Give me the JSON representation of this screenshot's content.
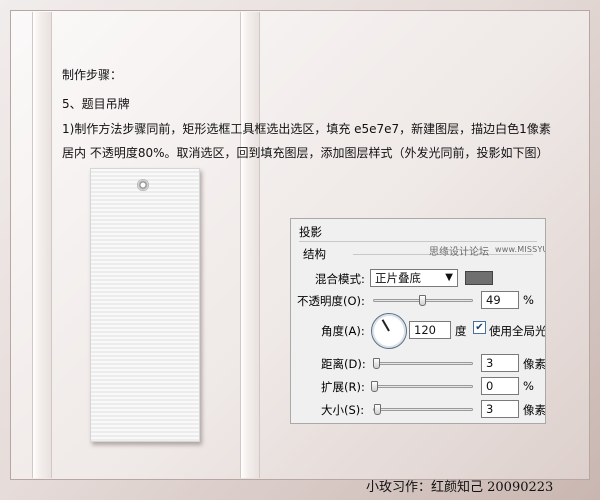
{
  "instructions": {
    "heading": "制作步骤：",
    "step_title": "5、题目吊牌",
    "line1": "1)制作方法步骤同前，矩形选框工具框选出选区，填充 e5e7e7，新建图层，描边白色1像素",
    "line2": "居内  不透明度80%。取消选区，回到填充图层，添加图层样式（外发光同前，投影如下图）"
  },
  "dialog": {
    "title": "投影",
    "section": "结构",
    "watermark_cn": "思缘设计论坛",
    "watermark_url": "www.MISSYUAN.COM",
    "blend_label": "混合模式:",
    "blend_value": "正片叠底",
    "blend_color": "#6f6f6f",
    "opacity_label": "不透明度(O):",
    "opacity_value": "49",
    "opacity_unit": "%",
    "opacity_fraction": 0.49,
    "angle_label": "角度(A):",
    "angle_value": "120",
    "angle_unit": "度",
    "global_light_label": "使用全局光",
    "global_light_checked": true,
    "distance_label": "距离(D):",
    "distance_value": "3",
    "distance_unit": "像素",
    "spread_label": "扩展(R):",
    "spread_value": "0",
    "spread_unit": "%",
    "size_label": "大小(S):",
    "size_value": "3",
    "size_unit": "像素"
  },
  "signature": "小玫习作：红颜知己  20090223"
}
